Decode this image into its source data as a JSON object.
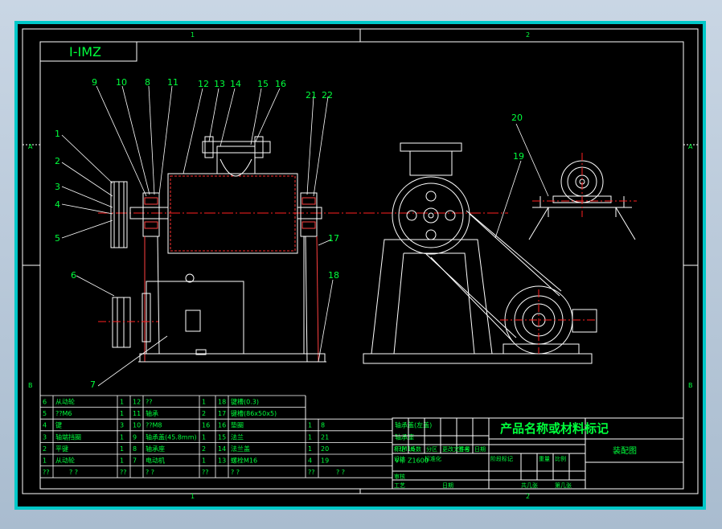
{
  "drawing": {
    "view_label": "I-IMZ",
    "title": "产品名称或材料标记",
    "subtitle": "装配图",
    "zone_top": [
      "1",
      "2"
    ],
    "zone_bottom": [
      "1",
      "2"
    ],
    "zone_left": [
      "A",
      "B"
    ],
    "zone_right": [
      "A",
      "B"
    ]
  },
  "balloons": [
    "1",
    "2",
    "3",
    "4",
    "5",
    "6",
    "7",
    "8",
    "9",
    "10",
    "11",
    "12",
    "13",
    "14",
    "15",
    "16",
    "17",
    "18",
    "19",
    "20",
    "21",
    "22"
  ],
  "bom": [
    {
      "c1": "6",
      "c2": "从动轮",
      "c3": "1",
      "c4": "12",
      "c5": "??",
      "c6": "1",
      "c7": "18",
      "c8": "键槽(0.3)"
    },
    {
      "c1": "5",
      "c2": "??M6",
      "c3": "1",
      "c4": "11",
      "c5": "轴承",
      "c6": "2",
      "c7": "17",
      "c8": "键槽(86x50x5)"
    },
    {
      "c1": "4",
      "c2": "键",
      "c3": "3",
      "c4": "10",
      "c5": "??M8",
      "c6": "16",
      "c7": "16",
      "c8": "垫圈",
      "c9": "1",
      "c10": "8",
      "c11": "轴承盖(左盖)"
    },
    {
      "c1": "3",
      "c2": "轴端挡圈",
      "c3": "1",
      "c4": "9",
      "c5": "轴承盖(45.8mm)",
      "c6": "1",
      "c7": "15",
      "c8": "法兰",
      "c9": "1",
      "c10": "21",
      "c11": "轴承座"
    },
    {
      "c1": "2",
      "c2": "平键",
      "c3": "1",
      "c4": "8",
      "c5": "轴承座",
      "c6": "2",
      "c7": "14",
      "c8": "法兰盖",
      "c9": "1",
      "c10": "20",
      "c11": "??M16"
    },
    {
      "c1": "1",
      "c2": "从动轮",
      "c3": "1",
      "c4": "7",
      "c5": "电动机",
      "c6": "1",
      "c7": "13",
      "c8": "螺栓M16",
      "c9": "4",
      "c10": "19",
      "c11": "V带 Z1600"
    }
  ],
  "bom_footer": [
    "??",
    "? ?",
    "??",
    "? ?",
    "??",
    "? ?",
    "??",
    "? ?"
  ],
  "title_block": {
    "row1": [
      "标记",
      "处数",
      "分区",
      "更改文件号",
      "签名",
      "日期"
    ],
    "row2": [
      "设计",
      "标准化",
      "阶段标记",
      "重量",
      "比例"
    ],
    "row3": [
      "审核"
    ],
    "row4": [
      "工艺",
      "日期",
      "共几张",
      "第几张"
    ]
  }
}
